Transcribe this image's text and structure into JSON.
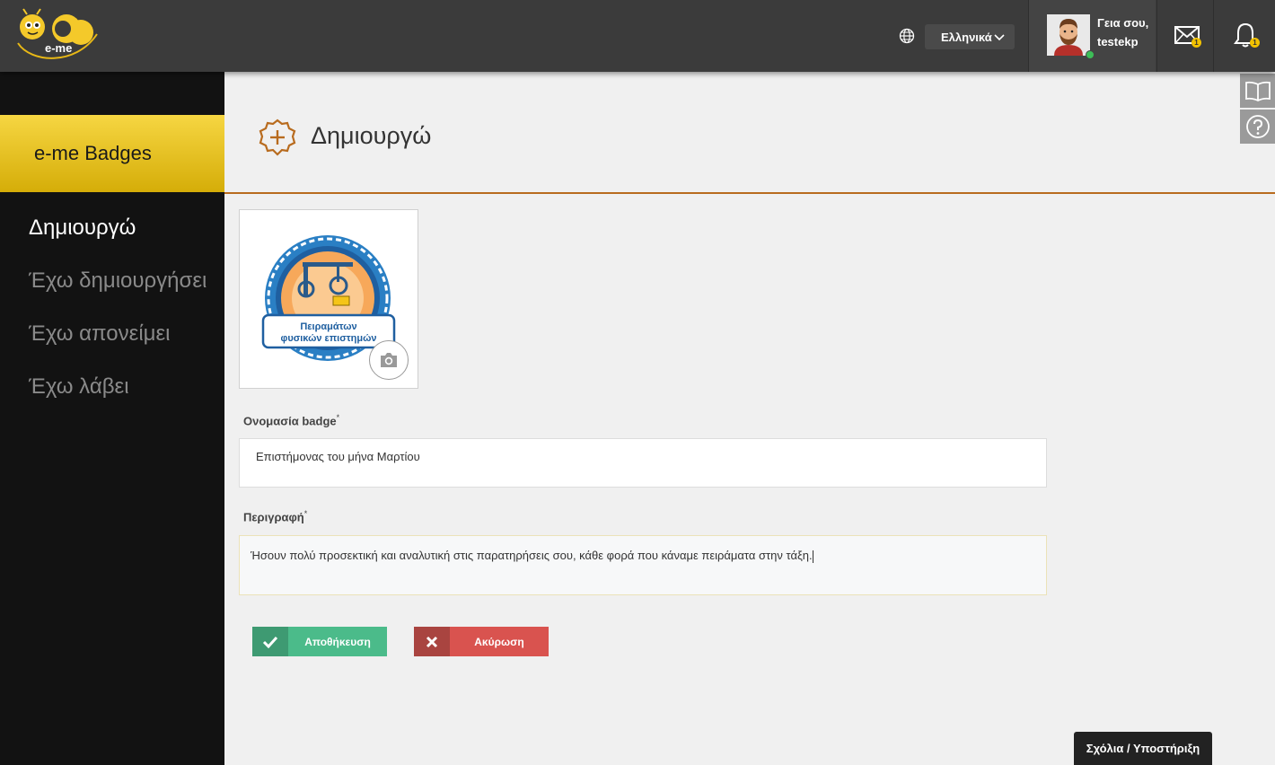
{
  "header": {
    "logo_text": "e-me",
    "language": "Ελληνικά",
    "greeting": "Γεια σου,",
    "username": "testekp",
    "messages_count": "1",
    "notifications_count": "1"
  },
  "sidebar": {
    "app_title": "e-me Badges",
    "items": [
      {
        "label": "Δημιουργώ",
        "active": true
      },
      {
        "label": "Έχω δημιουργήσει",
        "active": false
      },
      {
        "label": "Έχω απονείμει",
        "active": false
      },
      {
        "label": "Έχω λάβει",
        "active": false
      }
    ]
  },
  "page": {
    "title": "Δημιουργώ"
  },
  "badge_image": {
    "text_line1": "Πειραμάτων",
    "text_line2": "φυσικών επιστημών"
  },
  "form": {
    "name_label": "Ονομασία badge",
    "name_value": "Επιστήμονας του μήνα Μαρτίου",
    "desc_label": "Περιγραφή",
    "desc_value": "Ήσουν πολύ προσεκτική και αναλυτική στις παρατηρήσεις σου, κάθε φορά που κάναμε πειράματα στην τάξη.",
    "required_mark": "*"
  },
  "buttons": {
    "save": "Αποθήκευση",
    "cancel": "Ακύρωση"
  },
  "footer": {
    "support": "Σχόλια / Υποστήριξη"
  },
  "colors": {
    "accent_yellow": "#f6d642",
    "accent_orange": "#b86b1e",
    "save_green": "#4bbb8a",
    "cancel_red": "#d9534f"
  }
}
